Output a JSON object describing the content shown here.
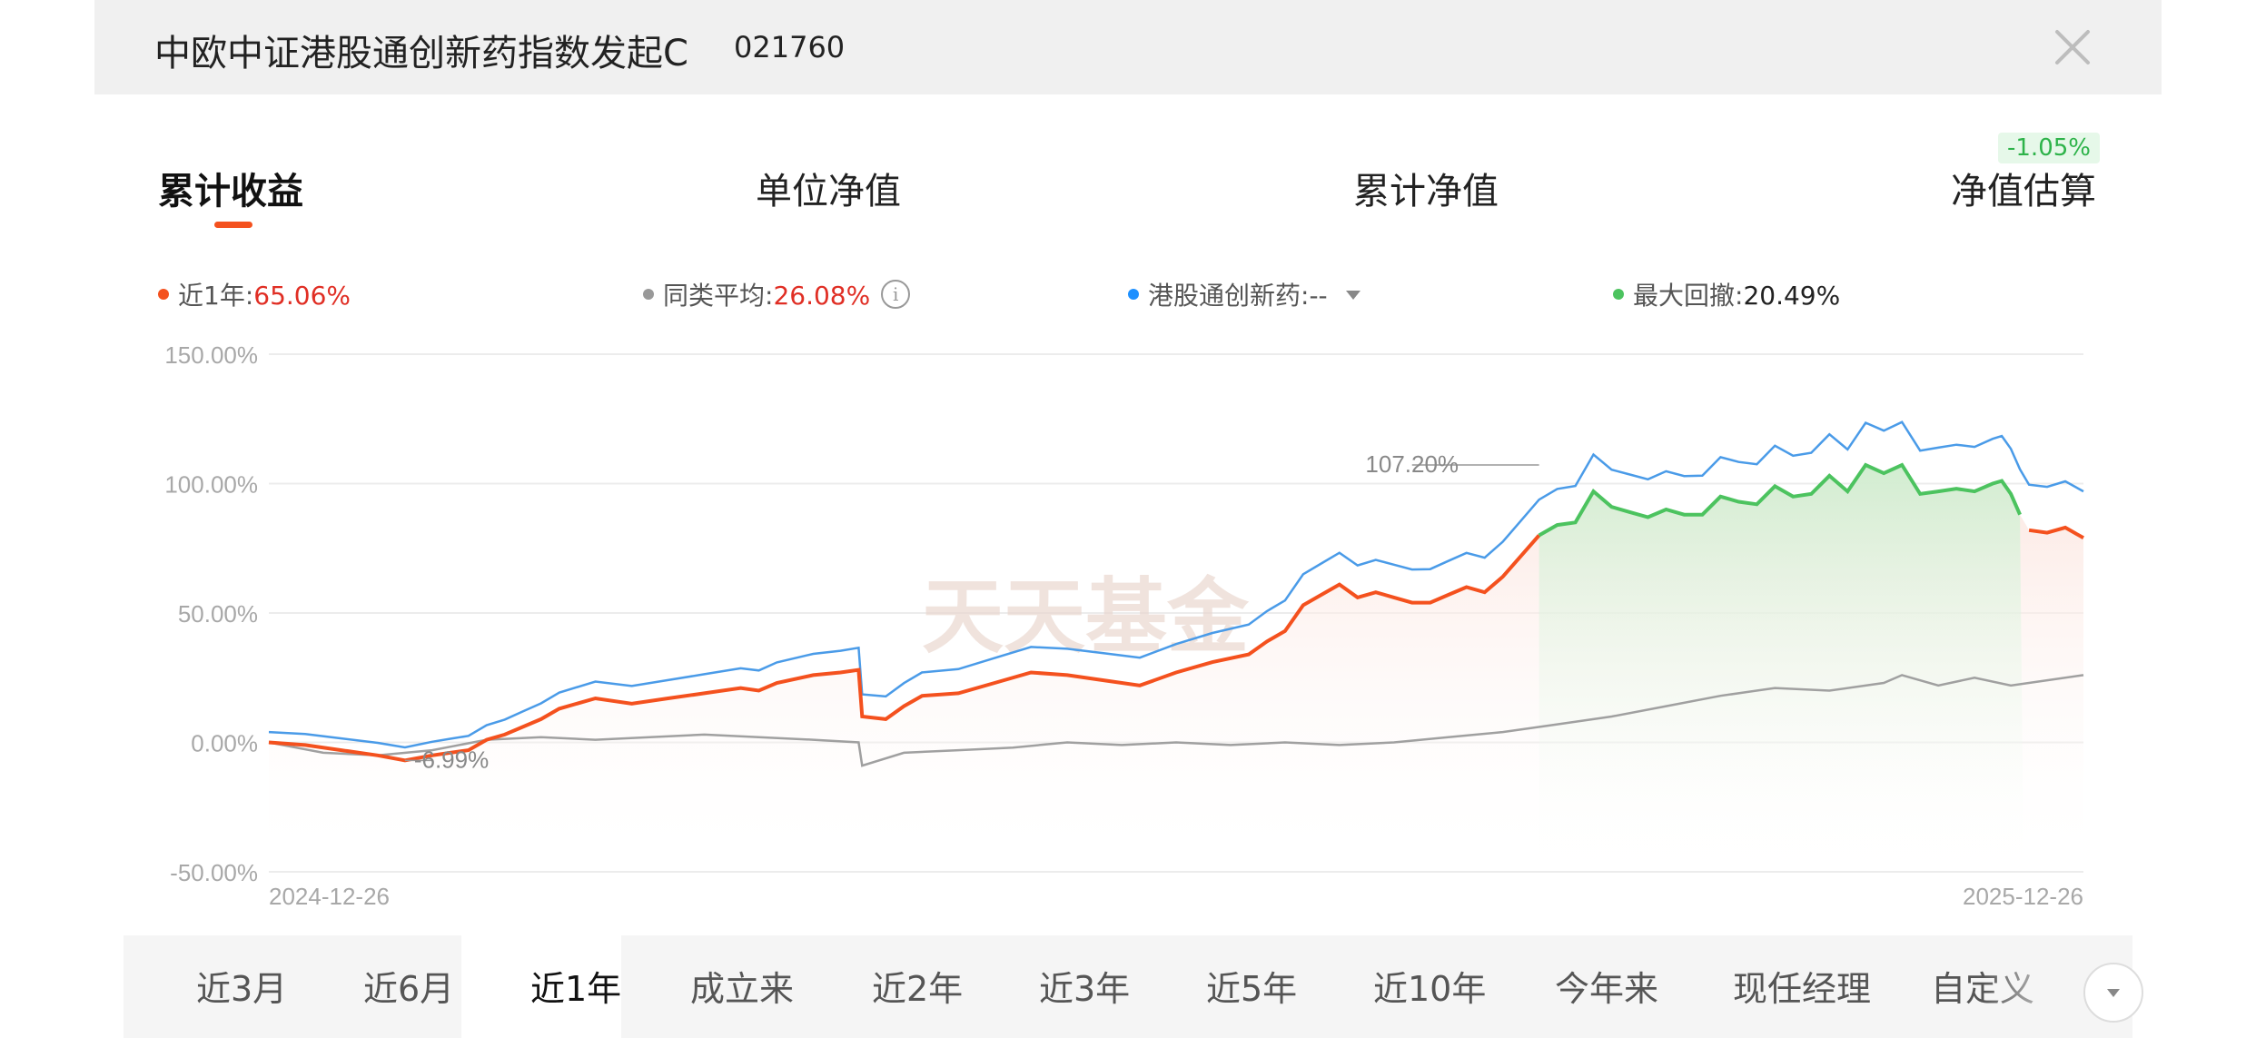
{
  "header": {
    "fund_name": "中欧中证港股通创新药指数发起C",
    "fund_code": "021760"
  },
  "tabs": [
    {
      "label": "累计收益",
      "active": true
    },
    {
      "label": "单位净值",
      "active": false
    },
    {
      "label": "累计净值",
      "active": false
    },
    {
      "label": "净值估算",
      "active": false
    }
  ],
  "estimate_badge": "-1.05%",
  "legend": {
    "fund": {
      "label": "近1年:",
      "value": "65.06%",
      "color": "#f4511e"
    },
    "peer": {
      "label": "同类平均:",
      "value": "26.08%",
      "color": "#999999"
    },
    "index": {
      "label": "港股通创新药:",
      "value": "--",
      "color": "#1e90ff"
    },
    "drawdown": {
      "label": "最大回撤:",
      "value": "20.49%",
      "color": "#4cc35f"
    }
  },
  "chart_data": {
    "type": "line",
    "ylim": [
      -50,
      150
    ],
    "y_ticks": [
      "150.00%",
      "100.00%",
      "50.00%",
      "0.00%",
      "-50.00%"
    ],
    "x_start_label": "2024-12-26",
    "x_end_label": "2025-12-26",
    "annotations": {
      "max_label": "107.20%",
      "min_label": "-6.99%",
      "watermark": "天天基金"
    },
    "drawdown_range": [
      0.7,
      0.967
    ],
    "series": [
      {
        "name": "近1年",
        "color": "#f4511e",
        "points": [
          [
            0,
            0
          ],
          [
            0.02,
            -1
          ],
          [
            0.04,
            -3
          ],
          [
            0.06,
            -5
          ],
          [
            0.075,
            -6.99
          ],
          [
            0.09,
            -5
          ],
          [
            0.1,
            -4
          ],
          [
            0.11,
            -3
          ],
          [
            0.12,
            1
          ],
          [
            0.13,
            3
          ],
          [
            0.14,
            6
          ],
          [
            0.15,
            9
          ],
          [
            0.16,
            13
          ],
          [
            0.18,
            17
          ],
          [
            0.2,
            15
          ],
          [
            0.22,
            17
          ],
          [
            0.24,
            19
          ],
          [
            0.26,
            21
          ],
          [
            0.27,
            20
          ],
          [
            0.28,
            23
          ],
          [
            0.3,
            26
          ],
          [
            0.315,
            27
          ],
          [
            0.325,
            28
          ],
          [
            0.327,
            10
          ],
          [
            0.34,
            9
          ],
          [
            0.35,
            14
          ],
          [
            0.36,
            18
          ],
          [
            0.38,
            19
          ],
          [
            0.4,
            23
          ],
          [
            0.42,
            27
          ],
          [
            0.44,
            26
          ],
          [
            0.46,
            24
          ],
          [
            0.48,
            22
          ],
          [
            0.5,
            27
          ],
          [
            0.52,
            31
          ],
          [
            0.54,
            34
          ],
          [
            0.55,
            39
          ],
          [
            0.56,
            43
          ],
          [
            0.57,
            53
          ],
          [
            0.58,
            57
          ],
          [
            0.59,
            61
          ],
          [
            0.6,
            56
          ],
          [
            0.61,
            58
          ],
          [
            0.62,
            56
          ],
          [
            0.63,
            54
          ],
          [
            0.64,
            54
          ],
          [
            0.65,
            57
          ],
          [
            0.66,
            60
          ],
          [
            0.67,
            58
          ],
          [
            0.68,
            64
          ],
          [
            0.69,
            72
          ],
          [
            0.7,
            80
          ],
          [
            0.71,
            84
          ],
          [
            0.72,
            85
          ],
          [
            0.73,
            97
          ],
          [
            0.74,
            91
          ],
          [
            0.75,
            89
          ],
          [
            0.76,
            87
          ],
          [
            0.77,
            90
          ],
          [
            0.78,
            88
          ],
          [
            0.79,
            88
          ],
          [
            0.8,
            95
          ],
          [
            0.81,
            93
          ],
          [
            0.82,
            92
          ],
          [
            0.83,
            99
          ],
          [
            0.84,
            95
          ],
          [
            0.85,
            96
          ],
          [
            0.86,
            103
          ],
          [
            0.87,
            97
          ],
          [
            0.88,
            107.2
          ],
          [
            0.89,
            104
          ],
          [
            0.9,
            107.2
          ],
          [
            0.91,
            96
          ],
          [
            0.92,
            97
          ],
          [
            0.93,
            98
          ],
          [
            0.94,
            97
          ],
          [
            0.95,
            100
          ],
          [
            0.955,
            101
          ],
          [
            0.96,
            96
          ],
          [
            0.965,
            88
          ],
          [
            0.97,
            82
          ],
          [
            0.98,
            81
          ],
          [
            0.99,
            83
          ],
          [
            1.0,
            79
          ]
        ]
      },
      {
        "name": "同类平均",
        "color": "#a0a0a0",
        "points": [
          [
            0,
            0
          ],
          [
            0.03,
            -4
          ],
          [
            0.06,
            -5
          ],
          [
            0.09,
            -3
          ],
          [
            0.12,
            1
          ],
          [
            0.15,
            2
          ],
          [
            0.18,
            1
          ],
          [
            0.21,
            2
          ],
          [
            0.24,
            3
          ],
          [
            0.27,
            2
          ],
          [
            0.3,
            1
          ],
          [
            0.325,
            0
          ],
          [
            0.327,
            -9
          ],
          [
            0.35,
            -4
          ],
          [
            0.38,
            -3
          ],
          [
            0.41,
            -2
          ],
          [
            0.44,
            0
          ],
          [
            0.47,
            -1
          ],
          [
            0.5,
            0
          ],
          [
            0.53,
            -1
          ],
          [
            0.56,
            0
          ],
          [
            0.59,
            -1
          ],
          [
            0.62,
            0
          ],
          [
            0.65,
            2
          ],
          [
            0.68,
            4
          ],
          [
            0.71,
            7
          ],
          [
            0.74,
            10
          ],
          [
            0.77,
            14
          ],
          [
            0.8,
            18
          ],
          [
            0.83,
            21
          ],
          [
            0.86,
            20
          ],
          [
            0.89,
            23
          ],
          [
            0.9,
            26
          ],
          [
            0.92,
            22
          ],
          [
            0.94,
            25
          ],
          [
            0.96,
            22
          ],
          [
            0.98,
            24
          ],
          [
            1.0,
            26
          ]
        ]
      }
    ]
  },
  "periods": [
    "近3月",
    "近6月",
    "近1年",
    "成立来",
    "近2年",
    "近3年",
    "近5年",
    "近10年",
    "今年来",
    "现任经理",
    "自定义"
  ],
  "active_period": "近1年"
}
